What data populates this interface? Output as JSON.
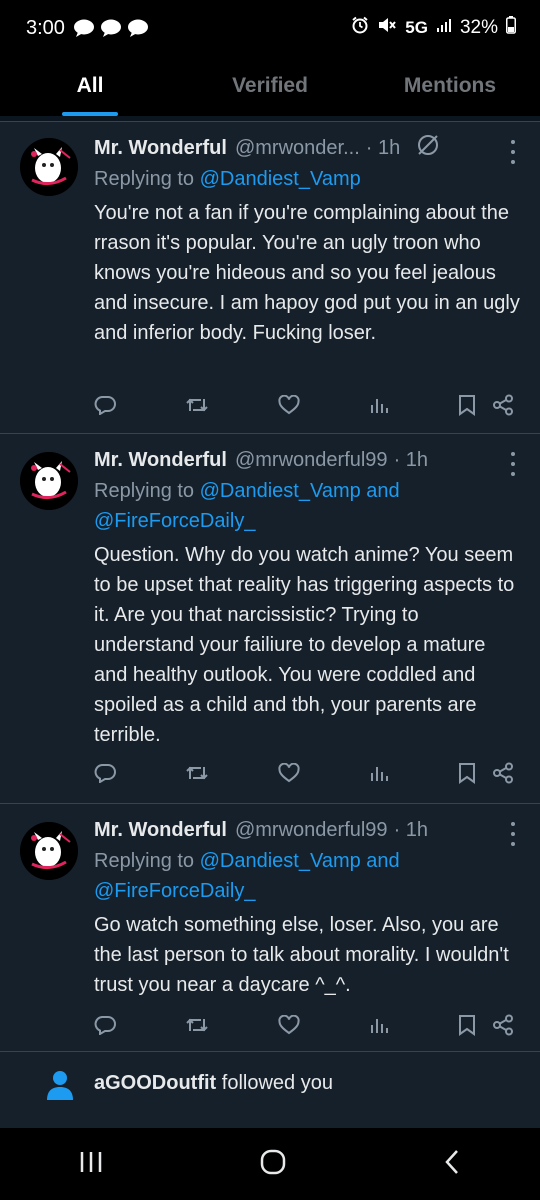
{
  "status_bar": {
    "time": "3:00",
    "network": "5G",
    "battery": "32%"
  },
  "tabs": [
    {
      "label": "All",
      "active": true
    },
    {
      "label": "Verified",
      "active": false
    },
    {
      "label": "Mentions",
      "active": false
    }
  ],
  "posts": [
    {
      "name": "Mr. Wonderful",
      "handle": "@mrwonder...",
      "time": "· 1h",
      "replying_prefix": "Replying to",
      "replying_to": "@Dandiest_Vamp",
      "replying_to_2": "",
      "text": "You're not a fan if you're complaining about the rrason it's popular. You're an ugly troon who knows you're hideous and so you feel jealous and insecure. I am hapoy god put you in an ugly and inferior body. Fucking loser."
    },
    {
      "name": "Mr. Wonderful",
      "handle": "@mrwonderful99",
      "time": "· 1h",
      "replying_prefix": "Replying to",
      "replying_to": "@Dandiest_Vamp",
      "replying_and": " and",
      "replying_to_2": "@FireForceDaily_",
      "text": "Question. Why do you watch anime? You seem to be upset that reality has triggering aspects to it. Are you that narcissistic? Trying to understand your failiure to develop a mature and healthy outlook. You were coddled and spoiled as a child and tbh, your parents are terrible."
    },
    {
      "name": "Mr. Wonderful",
      "handle": "@mrwonderful99",
      "time": "· 1h",
      "replying_prefix": "Replying to",
      "replying_to": "@Dandiest_Vamp",
      "replying_and": " and",
      "replying_to_2": "@FireForceDaily_",
      "text": "Go watch something else, loser. Also, you are the last person to talk about morality. I wouldn't trust you near a daycare ^_^."
    }
  ],
  "follow_notification": {
    "user": "aGOODoutfit",
    "action": " followed you"
  },
  "colors": {
    "background": "#15202b",
    "accent": "#1d9bf0",
    "muted": "#8b98a5"
  }
}
